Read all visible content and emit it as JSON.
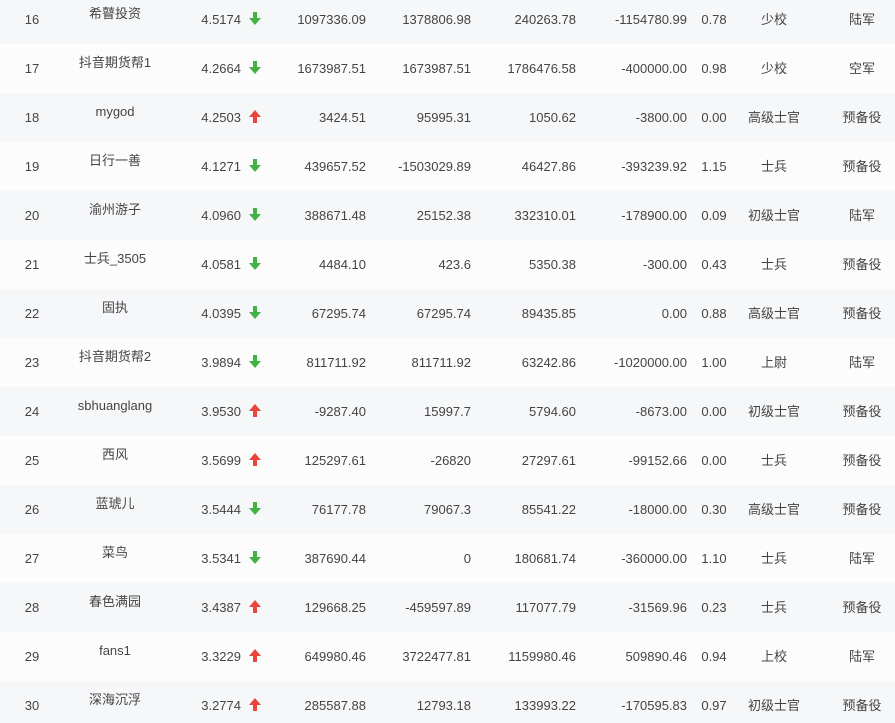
{
  "colors": {
    "up": "#e8453c",
    "down": "#43b244",
    "text": "#444444"
  },
  "icons": {
    "up": "arrow-up-icon",
    "down": "arrow-down-icon"
  },
  "rows": [
    {
      "rank": "16",
      "name": "希瞽投资",
      "score": "4.5174",
      "trend": "down",
      "v1": "1097336.09",
      "v2": "1378806.98",
      "v3": "240263.78",
      "v4": "-1154780.99",
      "ratio": "0.78",
      "title": "少校",
      "branch": "陆军"
    },
    {
      "rank": "17",
      "name": "抖音期货帮1",
      "score": "4.2664",
      "trend": "down",
      "v1": "1673987.51",
      "v2": "1673987.51",
      "v3": "1786476.58",
      "v4": "-400000.00",
      "ratio": "0.98",
      "title": "少校",
      "branch": "空军"
    },
    {
      "rank": "18",
      "name": "mygod",
      "score": "4.2503",
      "trend": "up",
      "v1": "3424.51",
      "v2": "95995.31",
      "v3": "1050.62",
      "v4": "-3800.00",
      "ratio": "0.00",
      "title": "高级士官",
      "branch": "预备役"
    },
    {
      "rank": "19",
      "name": "日行一善",
      "score": "4.1271",
      "trend": "down",
      "v1": "439657.52",
      "v2": "-1503029.89",
      "v3": "46427.86",
      "v4": "-393239.92",
      "ratio": "1.15",
      "title": "士兵",
      "branch": "预备役"
    },
    {
      "rank": "20",
      "name": "渝州游子",
      "score": "4.0960",
      "trend": "down",
      "v1": "388671.48",
      "v2": "25152.38",
      "v3": "332310.01",
      "v4": "-178900.00",
      "ratio": "0.09",
      "title": "初级士官",
      "branch": "陆军"
    },
    {
      "rank": "21",
      "name": "士兵_3505",
      "score": "4.0581",
      "trend": "down",
      "v1": "4484.10",
      "v2": "423.6",
      "v3": "5350.38",
      "v4": "-300.00",
      "ratio": "0.43",
      "title": "士兵",
      "branch": "预备役"
    },
    {
      "rank": "22",
      "name": "固执",
      "score": "4.0395",
      "trend": "down",
      "v1": "67295.74",
      "v2": "67295.74",
      "v3": "89435.85",
      "v4": "0.00",
      "ratio": "0.88",
      "title": "高级士官",
      "branch": "预备役"
    },
    {
      "rank": "23",
      "name": "抖音期货帮2",
      "score": "3.9894",
      "trend": "down",
      "v1": "811711.92",
      "v2": "811711.92",
      "v3": "63242.86",
      "v4": "-1020000.00",
      "ratio": "1.00",
      "title": "上尉",
      "branch": "陆军"
    },
    {
      "rank": "24",
      "name": "sbhuanglang",
      "score": "3.9530",
      "trend": "up",
      "v1": "-9287.40",
      "v2": "15997.7",
      "v3": "5794.60",
      "v4": "-8673.00",
      "ratio": "0.00",
      "title": "初级士官",
      "branch": "预备役"
    },
    {
      "rank": "25",
      "name": "西风",
      "score": "3.5699",
      "trend": "up",
      "v1": "125297.61",
      "v2": "-26820",
      "v3": "27297.61",
      "v4": "-99152.66",
      "ratio": "0.00",
      "title": "士兵",
      "branch": "预备役"
    },
    {
      "rank": "26",
      "name": "蓝琥儿",
      "score": "3.5444",
      "trend": "down",
      "v1": "76177.78",
      "v2": "79067.3",
      "v3": "85541.22",
      "v4": "-18000.00",
      "ratio": "0.30",
      "title": "高级士官",
      "branch": "预备役"
    },
    {
      "rank": "27",
      "name": "菜鸟",
      "score": "3.5341",
      "trend": "down",
      "v1": "387690.44",
      "v2": "0",
      "v3": "180681.74",
      "v4": "-360000.00",
      "ratio": "1.10",
      "title": "士兵",
      "branch": "陆军"
    },
    {
      "rank": "28",
      "name": "春色满园",
      "score": "3.4387",
      "trend": "up",
      "v1": "129668.25",
      "v2": "-459597.89",
      "v3": "117077.79",
      "v4": "-31569.96",
      "ratio": "0.23",
      "title": "士兵",
      "branch": "预备役"
    },
    {
      "rank": "29",
      "name": "fans1",
      "score": "3.3229",
      "trend": "up",
      "v1": "649980.46",
      "v2": "3722477.81",
      "v3": "1159980.46",
      "v4": "509890.46",
      "ratio": "0.94",
      "title": "上校",
      "branch": "陆军"
    },
    {
      "rank": "30",
      "name": "深海沉浮",
      "score": "3.2774",
      "trend": "up",
      "v1": "285587.88",
      "v2": "12793.18",
      "v3": "133993.22",
      "v4": "-170595.83",
      "ratio": "0.97",
      "title": "初级士官",
      "branch": "预备役"
    }
  ]
}
